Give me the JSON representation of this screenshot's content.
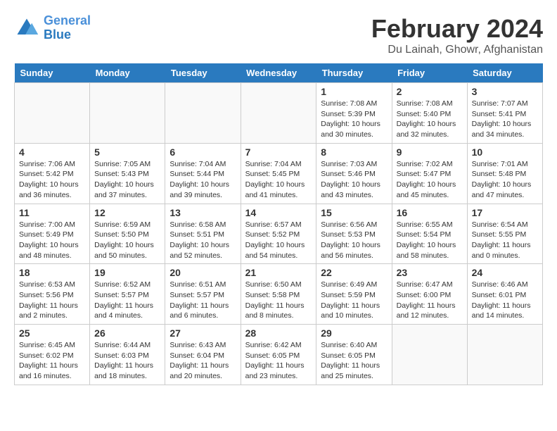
{
  "header": {
    "logo_line1": "General",
    "logo_line2": "Blue",
    "title": "February 2024",
    "subtitle": "Du Lainah, Ghowr, Afghanistan"
  },
  "days_of_week": [
    "Sunday",
    "Monday",
    "Tuesday",
    "Wednesday",
    "Thursday",
    "Friday",
    "Saturday"
  ],
  "weeks": [
    [
      {
        "day": "",
        "info": ""
      },
      {
        "day": "",
        "info": ""
      },
      {
        "day": "",
        "info": ""
      },
      {
        "day": "",
        "info": ""
      },
      {
        "day": "1",
        "info": "Sunrise: 7:08 AM\nSunset: 5:39 PM\nDaylight: 10 hours\nand 30 minutes."
      },
      {
        "day": "2",
        "info": "Sunrise: 7:08 AM\nSunset: 5:40 PM\nDaylight: 10 hours\nand 32 minutes."
      },
      {
        "day": "3",
        "info": "Sunrise: 7:07 AM\nSunset: 5:41 PM\nDaylight: 10 hours\nand 34 minutes."
      }
    ],
    [
      {
        "day": "4",
        "info": "Sunrise: 7:06 AM\nSunset: 5:42 PM\nDaylight: 10 hours\nand 36 minutes."
      },
      {
        "day": "5",
        "info": "Sunrise: 7:05 AM\nSunset: 5:43 PM\nDaylight: 10 hours\nand 37 minutes."
      },
      {
        "day": "6",
        "info": "Sunrise: 7:04 AM\nSunset: 5:44 PM\nDaylight: 10 hours\nand 39 minutes."
      },
      {
        "day": "7",
        "info": "Sunrise: 7:04 AM\nSunset: 5:45 PM\nDaylight: 10 hours\nand 41 minutes."
      },
      {
        "day": "8",
        "info": "Sunrise: 7:03 AM\nSunset: 5:46 PM\nDaylight: 10 hours\nand 43 minutes."
      },
      {
        "day": "9",
        "info": "Sunrise: 7:02 AM\nSunset: 5:47 PM\nDaylight: 10 hours\nand 45 minutes."
      },
      {
        "day": "10",
        "info": "Sunrise: 7:01 AM\nSunset: 5:48 PM\nDaylight: 10 hours\nand 47 minutes."
      }
    ],
    [
      {
        "day": "11",
        "info": "Sunrise: 7:00 AM\nSunset: 5:49 PM\nDaylight: 10 hours\nand 48 minutes."
      },
      {
        "day": "12",
        "info": "Sunrise: 6:59 AM\nSunset: 5:50 PM\nDaylight: 10 hours\nand 50 minutes."
      },
      {
        "day": "13",
        "info": "Sunrise: 6:58 AM\nSunset: 5:51 PM\nDaylight: 10 hours\nand 52 minutes."
      },
      {
        "day": "14",
        "info": "Sunrise: 6:57 AM\nSunset: 5:52 PM\nDaylight: 10 hours\nand 54 minutes."
      },
      {
        "day": "15",
        "info": "Sunrise: 6:56 AM\nSunset: 5:53 PM\nDaylight: 10 hours\nand 56 minutes."
      },
      {
        "day": "16",
        "info": "Sunrise: 6:55 AM\nSunset: 5:54 PM\nDaylight: 10 hours\nand 58 minutes."
      },
      {
        "day": "17",
        "info": "Sunrise: 6:54 AM\nSunset: 5:55 PM\nDaylight: 11 hours\nand 0 minutes."
      }
    ],
    [
      {
        "day": "18",
        "info": "Sunrise: 6:53 AM\nSunset: 5:56 PM\nDaylight: 11 hours\nand 2 minutes."
      },
      {
        "day": "19",
        "info": "Sunrise: 6:52 AM\nSunset: 5:57 PM\nDaylight: 11 hours\nand 4 minutes."
      },
      {
        "day": "20",
        "info": "Sunrise: 6:51 AM\nSunset: 5:57 PM\nDaylight: 11 hours\nand 6 minutes."
      },
      {
        "day": "21",
        "info": "Sunrise: 6:50 AM\nSunset: 5:58 PM\nDaylight: 11 hours\nand 8 minutes."
      },
      {
        "day": "22",
        "info": "Sunrise: 6:49 AM\nSunset: 5:59 PM\nDaylight: 11 hours\nand 10 minutes."
      },
      {
        "day": "23",
        "info": "Sunrise: 6:47 AM\nSunset: 6:00 PM\nDaylight: 11 hours\nand 12 minutes."
      },
      {
        "day": "24",
        "info": "Sunrise: 6:46 AM\nSunset: 6:01 PM\nDaylight: 11 hours\nand 14 minutes."
      }
    ],
    [
      {
        "day": "25",
        "info": "Sunrise: 6:45 AM\nSunset: 6:02 PM\nDaylight: 11 hours\nand 16 minutes."
      },
      {
        "day": "26",
        "info": "Sunrise: 6:44 AM\nSunset: 6:03 PM\nDaylight: 11 hours\nand 18 minutes."
      },
      {
        "day": "27",
        "info": "Sunrise: 6:43 AM\nSunset: 6:04 PM\nDaylight: 11 hours\nand 20 minutes."
      },
      {
        "day": "28",
        "info": "Sunrise: 6:42 AM\nSunset: 6:05 PM\nDaylight: 11 hours\nand 23 minutes."
      },
      {
        "day": "29",
        "info": "Sunrise: 6:40 AM\nSunset: 6:05 PM\nDaylight: 11 hours\nand 25 minutes."
      },
      {
        "day": "",
        "info": ""
      },
      {
        "day": "",
        "info": ""
      }
    ]
  ]
}
